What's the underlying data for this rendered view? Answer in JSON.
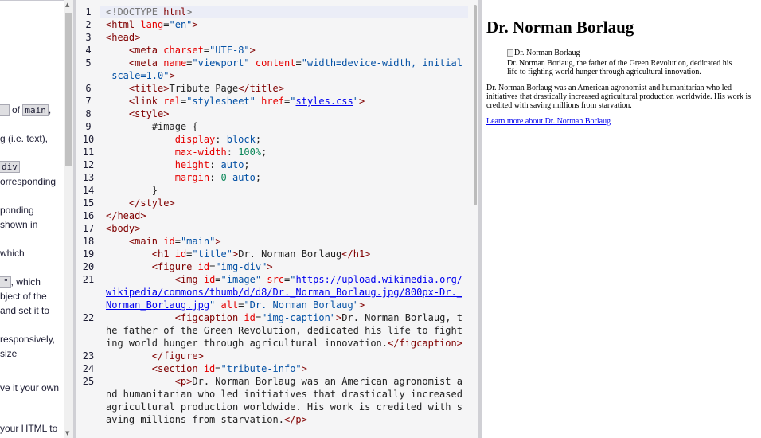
{
  "instructions": {
    "fragments": [
      {
        "pre": "",
        "code": "",
        "post": ""
      },
      {
        "pre": "",
        "code": "main",
        "post": ","
      },
      {
        "pre": "g (i.e. text),",
        "code": "",
        "post": ""
      },
      {
        "pre": "",
        "code": "div",
        "post": ""
      },
      {
        "pre": "orresponding",
        "code": "",
        "post": ""
      },
      {
        "pre": "ponding",
        "code": "",
        "post": ""
      },
      {
        "pre": " shown in",
        "code": "",
        "post": ""
      },
      {
        "pre": "which",
        "code": "",
        "post": ""
      },
      {
        "pre": "",
        "code": "\"",
        "post": ", which"
      },
      {
        "pre": "bject of the",
        "code": "",
        "post": ""
      },
      {
        "pre": "and set it to",
        "code": "",
        "post": ""
      },
      {
        "pre": "responsively,",
        "code": "",
        "post": ""
      },
      {
        "pre": "size",
        "code": "",
        "post": ""
      },
      {
        "pre": "ve it your own",
        "code": "",
        "post": ""
      },
      {
        "pre": "your HTML to",
        "code": "",
        "post": ""
      }
    ],
    "of_text": "of"
  },
  "editor": {
    "lines": [
      {
        "n": "1",
        "html": "<span class='dt'>&lt;!DOCTYPE <span class='tg'>html</span>&gt;</span>"
      },
      {
        "n": "2",
        "html": "<span class='tg'>&lt;html</span> <span class='at'>lang</span>=<span class='av'>\"en\"</span><span class='tg'>&gt;</span>"
      },
      {
        "n": "3",
        "html": "<span class='tg'>&lt;head&gt;</span>"
      },
      {
        "n": "4",
        "html": "    <span class='tg'>&lt;meta</span> <span class='at'>charset</span>=<span class='av'>\"UTF-8\"</span><span class='tg'>&gt;</span>"
      },
      {
        "n": "5",
        "html": "    <span class='tg'>&lt;meta</span> <span class='at'>name</span>=<span class='av'>\"viewport\"</span> <span class='at'>content</span>=<span class='av'>\"width=device-width, initial-scale=1.0\"</span><span class='tg'>&gt;</span>"
      },
      {
        "n": "6",
        "html": "    <span class='tg'>&lt;title&gt;</span>Tribute Page<span class='tg'>&lt;/title&gt;</span>"
      },
      {
        "n": "7",
        "html": "    <span class='tg'>&lt;link</span> <span class='at'>rel</span>=<span class='av'>\"stylesheet\"</span> <span class='at'>href</span>=<span class='av'>\"<span class='ln-link'>styles.css</span>\"</span><span class='tg'>&gt;</span>"
      },
      {
        "n": "8",
        "html": "    <span class='tg'>&lt;style&gt;</span>"
      },
      {
        "n": "9",
        "html": "        #image {"
      },
      {
        "n": "10",
        "html": "            <span class='pr'>display</span>: <span class='vl'>block</span>;"
      },
      {
        "n": "11",
        "html": "            <span class='pr'>max-width</span>: <span class='nm'>100%</span>;"
      },
      {
        "n": "12",
        "html": "            <span class='pr'>height</span>: <span class='vl'>auto</span>;"
      },
      {
        "n": "13",
        "html": "            <span class='pr'>margin</span>: <span class='nm'>0</span> <span class='vl'>auto</span>;"
      },
      {
        "n": "14",
        "html": "        }"
      },
      {
        "n": "15",
        "html": "    <span class='tg'>&lt;/style&gt;</span>"
      },
      {
        "n": "16",
        "html": "<span class='tg'>&lt;/head&gt;</span>"
      },
      {
        "n": "17",
        "html": "<span class='tg'>&lt;body&gt;</span>"
      },
      {
        "n": "18",
        "html": "    <span class='tg'>&lt;main</span> <span class='at'>id</span>=<span class='av'>\"main\"</span><span class='tg'>&gt;</span>"
      },
      {
        "n": "19",
        "html": "        <span class='tg'>&lt;h1</span> <span class='at'>id</span>=<span class='av'>\"title\"</span><span class='tg'>&gt;</span>Dr. Norman Borlaug<span class='tg'>&lt;/h1&gt;</span>"
      },
      {
        "n": "20",
        "html": "        <span class='tg'>&lt;figure</span> <span class='at'>id</span>=<span class='av'>\"img-div\"</span><span class='tg'>&gt;</span>"
      },
      {
        "n": "21",
        "html": "            <span class='tg'>&lt;img</span> <span class='at'>id</span>=<span class='av'>\"image\"</span> <span class='at'>src</span>=<span class='av'>\"<span class='ln-link'>https://upload.wikimedia.org/wikipedia/commons/thumb/d/d8/Dr._Norman_Borlaug.jpg/800px-Dr._Norman_Borlaug.jpg</span>\"</span> <span class='at'>alt</span>=<span class='av'>\"Dr. Norman Borlaug\"</span><span class='tg'>&gt;</span>"
      },
      {
        "n": "22",
        "html": "            <span class='tg'>&lt;figcaption</span> <span class='at'>id</span>=<span class='av'>\"img-caption\"</span><span class='tg'>&gt;</span>Dr. Norman Borlaug, the father of the Green Revolution, dedicated his life to fighting world hunger through agricultural innovation.<span class='tg'>&lt;/figcaption&gt;</span>"
      },
      {
        "n": "23",
        "html": "        <span class='tg'>&lt;/figure&gt;</span>"
      },
      {
        "n": "24",
        "html": "        <span class='tg'>&lt;section</span> <span class='at'>id</span>=<span class='av'>\"tribute-info\"</span><span class='tg'>&gt;</span>"
      },
      {
        "n": "25",
        "html": "            <span class='tg'>&lt;p&gt;</span>Dr. Norman Borlaug was an American agronomist and humanitarian who led initiatives that drastically increased agricultural production worldwide. His work is credited with saving millions from starvation.<span class='tg'>&lt;/p&gt;</span>"
      }
    ]
  },
  "preview": {
    "title": "Dr. Norman Borlaug",
    "img_alt": "Dr. Norman Borlaug",
    "caption": "Dr. Norman Borlaug, the father of the Green Revolution, dedicated his life to fighting world hunger through agricultural innovation.",
    "info": "Dr. Norman Borlaug was an American agronomist and humanitarian who led initiatives that drastically increased agricultural production worldwide. His work is credited with saving millions from starvation.",
    "link": "Learn more about Dr. Norman Borlaug"
  }
}
